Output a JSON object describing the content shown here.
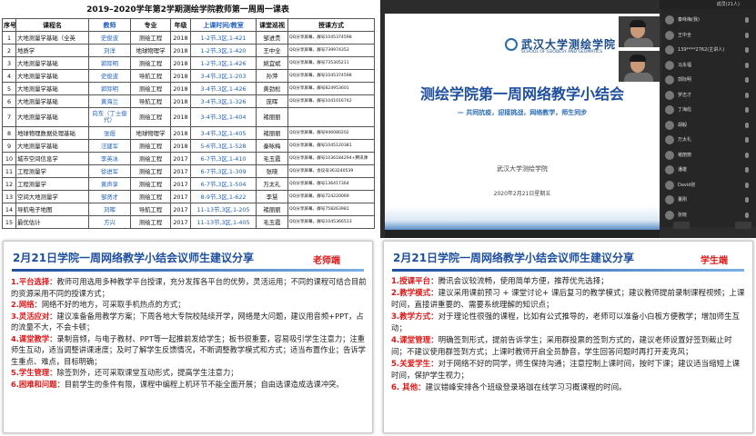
{
  "table_panel": {
    "title": "2019–2020学年第2学期测绘学院教师第一周周一课表",
    "headers": [
      "序号",
      "课程名",
      "教师",
      "专业",
      "年级",
      "上课时间/教室",
      "课堂巡视",
      "授课方式"
    ],
    "rows": [
      [
        "1",
        "大地测量学基础（全英",
        "史俊波",
        "测绘工程",
        "2018",
        "1-2节,3区,1-421",
        "邹进贵",
        "QQ分享屏幕，群号1045374598"
      ],
      [
        "2",
        "地质学",
        "刘洋",
        "地球物理学",
        "2018",
        "1-2节,3区,1-420",
        "王中全",
        "QQ分享屏幕，群号739974353"
      ],
      [
        "3",
        "大地测量学基础",
        "郭际明",
        "测绘工程",
        "2018",
        "1-2节,3区,1-426",
        "姚宜斌",
        "QQ分享屏幕，群号735305211"
      ],
      [
        "4",
        "大地测量学基础",
        "史俊波",
        "导航工程",
        "2018",
        "3-4节,3区,1-203",
        "孙萍",
        "QQ分享屏幕，群号1045374598"
      ],
      [
        "5",
        "大地测量学基础",
        "郭际明",
        "测绘工程",
        "2018",
        "3-4节,3区,1-426",
        "黄劲松",
        "QQ分享屏幕，群号824953601"
      ],
      [
        "6",
        "大地测量学基础",
        "黄海兰",
        "导航工程",
        "2018",
        "3-4节,3区,1-326",
        "庞晖",
        "QQ分享屏幕，群号1041016742"
      ],
      [
        "7",
        "大地测量学基础",
        "向东（丁士俊代）",
        "测绘工程",
        "2018",
        "3-4节,3区,1-404",
        "褚丽丽",
        ""
      ],
      [
        "8",
        "地球物理数据处理基础",
        "张煜",
        "地球物理学",
        "2018",
        "3-4节,3区,1-405",
        "褚丽丽",
        "QQ分享屏幕，群号946080202"
      ],
      [
        "9",
        "大地测量学基础",
        "汪建军",
        "测绘工程",
        "2018",
        "5-6节,3区,1-528",
        "秦咏梅",
        "QQ分享屏幕，群号1045120381"
      ],
      [
        "10",
        "城市空间信息学",
        "李英冰",
        "测绘工程",
        "2017",
        "6-7节,3区,1-410",
        "毛玉霞",
        "QQ分享屏幕，群号1036184294+腾讯课"
      ],
      [
        "11",
        "工程测量学",
        "徐进军",
        "测绘工程",
        "2017",
        "6-7节,3区,1-309",
        "张晓",
        "QQ分享屏幕，会议号363240539"
      ],
      [
        "12",
        "工程测量学",
        "黄声享",
        "测绘工程",
        "2017",
        "6-7节,3区,1-504",
        "万太礼",
        "QQ分享屏幕，群号136417364"
      ],
      [
        "13",
        "空间大地测量学",
        "邹贤才",
        "测绘工程",
        "2017",
        "8-9节,3区,1-622",
        "李慧",
        "QQ分享屏幕，群号724220069"
      ],
      [
        "14",
        "导航电子地图",
        "刘晖",
        "导航工程",
        "2017",
        "11-13节,3区,1-205",
        "褚丽丽",
        "QQ分享屏幕，群号758263981"
      ],
      [
        "15",
        "最优估计",
        "方兴",
        "测绘工程",
        "2017",
        "11-13节,3区,1-405",
        "毛玉霞",
        "QQ分享屏幕，群号1045366513"
      ]
    ]
  },
  "meeting_panel": {
    "slide_university": "武汉大学测绘学院",
    "slide_school_en": "SCHOOL OF GEODESY AND GEOMATICS",
    "slide_title": "测绘学院第一周网络教学小结会",
    "slide_subtitle": "— 共同抗疫，迎接挑战，网络教学，师生同步",
    "slide_org": "武汉大学测绘学院",
    "slide_date": "2020年2月21日星期五",
    "top_bar_label": "成员(21人)",
    "participants": [
      "秦咏梅(我)",
      "王中全",
      "139****2762(主讲人)",
      "马永福",
      "郭际明",
      "罗志才",
      "丁海彪",
      "胡毅",
      "万太礼",
      "褚丽丽",
      "潘雄",
      "David张",
      "董刚",
      "张晓"
    ]
  },
  "teacher_card": {
    "title": "2月21日学院一周网络教学小结会议师生建议分享",
    "tag": "老师端",
    "items": [
      {
        "key": "1.平台选择：",
        "text": "教师可用选用多种教学平台授课，充分发挥各平台的优势，灵活运用；不同的课程可结合目前的资源采用不同的授课方式；"
      },
      {
        "key": "2.网络：",
        "text": "网络不好的地方，可采取手机热点的方式；"
      },
      {
        "key": "3.灵活应对：",
        "text": "建议准备备用教学方案；下周各地大专院校陆续开学，网络是大问题，建议用音频+PPT，占的流量不大，不会卡顿；"
      },
      {
        "key": "4.课堂教学：",
        "text": "录制音频，与电子教材、PPT等一起推前发给学生；板书很重要，容易吸引学生注意力；注重师生互动，适当调整讲课速度；及时了解学生反馈情况，不断调整教学模式和方式；适当布置作业；告诉学生重点、难点，目标明确；"
      },
      {
        "key": "5.学生管理：",
        "text": "除签到外，还可采取课堂互动形式，提高学生注意力；"
      },
      {
        "key": "6.困难和问题：",
        "text": "目前学生的条件有限，课程中编程上机环节不能全面开展；自由选课造成选课冲突。"
      }
    ]
  },
  "student_card": {
    "title": "2月21日学院一周网络教学小结会议师生建议分享",
    "tag": "学生端",
    "items": [
      {
        "key": "1.授课平台：",
        "text": "腾讯会议较流畅，使用简单方便，推荐优先选择；"
      },
      {
        "key": "2.教学模式：",
        "text": "建议采用课前预习 + 课堂讨论+ 课后复习的教学模式；建议教师提前录制课程视频；上课时间，直接讲重要的、需要系统理解的知识点；"
      },
      {
        "key": "3.教学方式：",
        "text": "对于理论性很强的课程，比如有公式推导的，老师可以准备小白板方便教学；增加师生互动；"
      },
      {
        "key": "4.课堂管理：",
        "text": "明确签到形式，提前告诉学生；采用群投票的签到方式的，建议老师设置好签到截止时间；不建议使用群签到方式；上课时教师开启全员静音，学生回答问题时再打开麦克风；"
      },
      {
        "key": "5.关爱学生：",
        "text": "对于网络不好的同学，师生保持沟通；注意控制上课时间，按时下课；建议适当缩短上课时间，保护学生视力；"
      },
      {
        "key": "6. 其他：",
        "text": "建议错峰安排各个班级登录珞珈在线学习习概课程的时间。"
      }
    ]
  }
}
